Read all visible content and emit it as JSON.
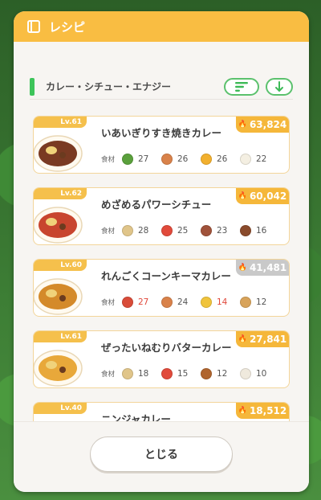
{
  "header": {
    "title": "レシピ"
  },
  "filter": {
    "label": "カレー・シチュー・エナジー"
  },
  "ingredients_label": "食材",
  "recipes": [
    {
      "level": "Lv.61",
      "name": "いあいぎりすき焼きカレー",
      "energy": "63,824",
      "energy_color": "#f5b73a",
      "ingredients": [
        {
          "icon": "leek-icon",
          "color": "#5aa03c",
          "value": "27",
          "red": false
        },
        {
          "icon": "sausage-icon",
          "color": "#d9824a",
          "value": "26",
          "red": false
        },
        {
          "icon": "honey-icon",
          "color": "#f2b02e",
          "value": "26",
          "red": false
        },
        {
          "icon": "egg-icon",
          "color": "#f4efe2",
          "value": "22",
          "red": false
        }
      ]
    },
    {
      "level": "Lv.62",
      "name": "めざめるパワーシチュー",
      "energy": "60,042",
      "energy_color": "#f5b73a",
      "ingredients": [
        {
          "icon": "potato-icon",
          "color": "#e0c58a",
          "value": "28",
          "red": false
        },
        {
          "icon": "tomato-icon",
          "color": "#e14a3b",
          "value": "25",
          "red": false
        },
        {
          "icon": "mushroom-icon",
          "color": "#a0523a",
          "value": "23",
          "red": false
        },
        {
          "icon": "beans-icon",
          "color": "#8a4b2c",
          "value": "16",
          "red": false
        }
      ]
    },
    {
      "level": "Lv.60",
      "name": "れんごくコーンキーマカレー",
      "energy": "41,481",
      "energy_color": "#c9c9c9",
      "ingredients": [
        {
          "icon": "herb-icon",
          "color": "#d94c39",
          "value": "27",
          "red": true
        },
        {
          "icon": "sausage-icon",
          "color": "#d9824a",
          "value": "24",
          "red": false
        },
        {
          "icon": "corn-icon",
          "color": "#f0c43c",
          "value": "14",
          "red": true
        },
        {
          "icon": "ginger-icon",
          "color": "#d8a35a",
          "value": "12",
          "red": false
        }
      ]
    },
    {
      "level": "Lv.61",
      "name": "ぜったいねむりバターカレー",
      "energy": "27,841",
      "energy_color": "#f5b73a",
      "ingredients": [
        {
          "icon": "potato-icon",
          "color": "#e0c58a",
          "value": "18",
          "red": false
        },
        {
          "icon": "tomato-icon",
          "color": "#e14a3b",
          "value": "15",
          "red": false
        },
        {
          "icon": "cacao-icon",
          "color": "#b0652e",
          "value": "12",
          "red": false
        },
        {
          "icon": "milk-icon",
          "color": "#efe9dd",
          "value": "10",
          "red": false
        }
      ]
    },
    {
      "level": "Lv.40",
      "name": "ニンジャカレー",
      "energy": "18,512",
      "energy_color": "#f5b73a",
      "ingredients": []
    }
  ],
  "footer": {
    "close_label": "とじる"
  }
}
